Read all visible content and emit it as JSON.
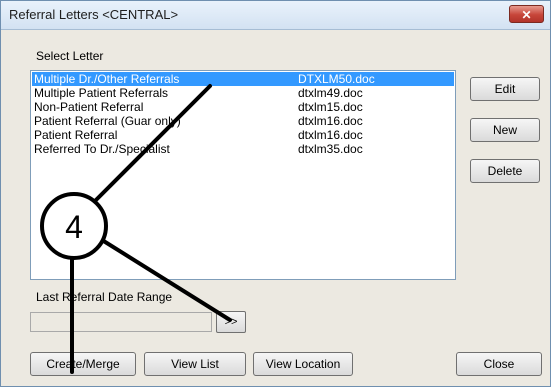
{
  "window": {
    "title": "Referral Letters <CENTRAL>",
    "close_glyph": "✕"
  },
  "select_letter_label": "Select Letter",
  "letters": [
    {
      "name": "Multiple Dr./Other Referrals",
      "file": "DTXLM50.doc",
      "selected": true
    },
    {
      "name": "Multiple Patient Referrals",
      "file": "dtxlm49.doc",
      "selected": false
    },
    {
      "name": "Non-Patient Referral",
      "file": "dtxlm15.doc",
      "selected": false
    },
    {
      "name": "Patient Referral (Guar only)",
      "file": "dtxlm16.doc",
      "selected": false
    },
    {
      "name": "Patient Referral",
      "file": "dtxlm16.doc",
      "selected": false
    },
    {
      "name": "Referred To Dr./Specialist",
      "file": "dtxlm35.doc",
      "selected": false
    }
  ],
  "side_buttons": {
    "edit": "Edit",
    "new": "New",
    "delete": "Delete"
  },
  "date_range": {
    "label": "Last Referral Date Range",
    "value": "",
    "button": ">>"
  },
  "bottom_buttons": {
    "create_merge": "Create/Merge",
    "view_list": "View List",
    "view_location": "View Location",
    "close": "Close"
  },
  "callout": {
    "number": "4"
  },
  "colors": {
    "selection": "#3399ff",
    "dialog_bg": "#ece9e1",
    "close_red": "#c7453a"
  }
}
